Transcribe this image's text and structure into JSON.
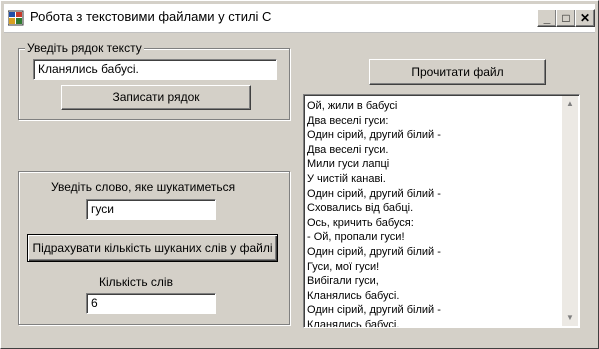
{
  "window": {
    "title": "Робота з текстовими файлами у стилі С",
    "controls": {
      "minimize": "_",
      "maximize": "□",
      "close": "✕"
    }
  },
  "write_group": {
    "legend": "Уведіть рядок тексту",
    "input_value": "Кланялись бабусі.",
    "write_button": "Записати рядок"
  },
  "search_group": {
    "prompt": "Уведіть слово, яке шукатиметься",
    "search_value": "гуси",
    "count_button": "Підрахувати кількість шуканих слів у файлі",
    "count_label": "Кількість слів",
    "count_value": "6"
  },
  "read_button": "Прочитати файл",
  "memo": {
    "lines": [
      "Ой, жили в бабусі",
      "Два веселі гуси:",
      "Один сірий, другий білий -",
      "Два веселі гуси.",
      "Мили гуси лапці",
      "У чистій канаві.",
      "Один сірий, другий білий -",
      "Сховались від бабці.",
      "Ось, кричить бабуся:",
      "- Ой, пропали гуси!",
      "Один сірий, другий білий -",
      "Гуси, мої гуси!",
      "Вибігали гуси,",
      "Кланялись бабусі.",
      "Один сірий, другий білий -",
      "Кланялись бабусі."
    ]
  }
}
